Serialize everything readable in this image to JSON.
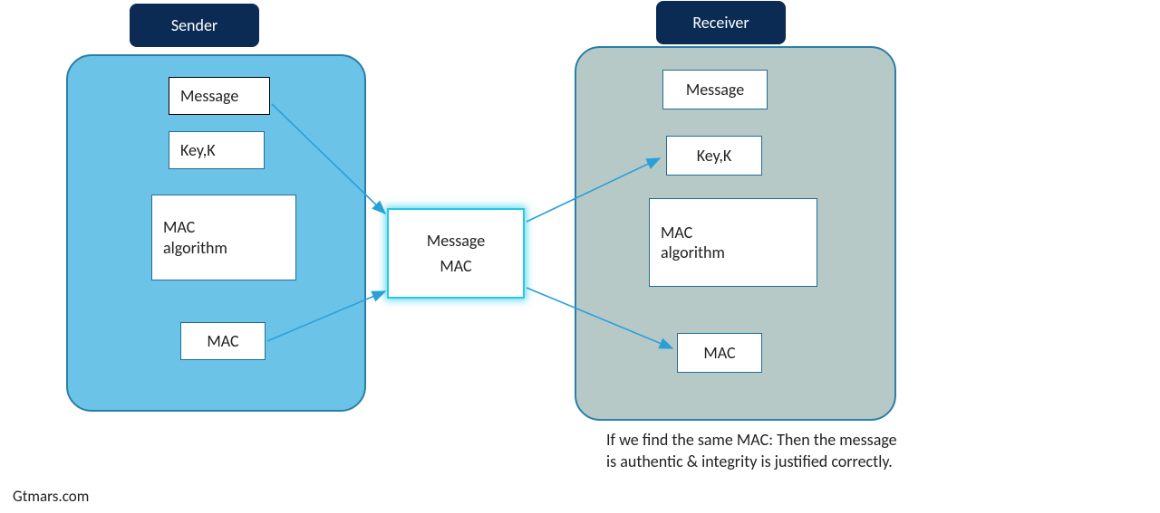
{
  "headers": {
    "sender": "Sender",
    "receiver": "Receiver"
  },
  "sender": {
    "message": "Message",
    "key": "Key,K",
    "alg_line1": "MAC",
    "alg_line2": "algorithm",
    "mac": "MAC"
  },
  "receiver": {
    "message": "Message",
    "key": "Key,K",
    "alg_line1": "MAC",
    "alg_line2": "algorithm",
    "mac": "MAC"
  },
  "center": {
    "line1": "Message",
    "line2": "MAC"
  },
  "caption": "If we find the same MAC: Then the message is authentic & integrity is justified correctly.",
  "footer": "Gtmars.com"
}
